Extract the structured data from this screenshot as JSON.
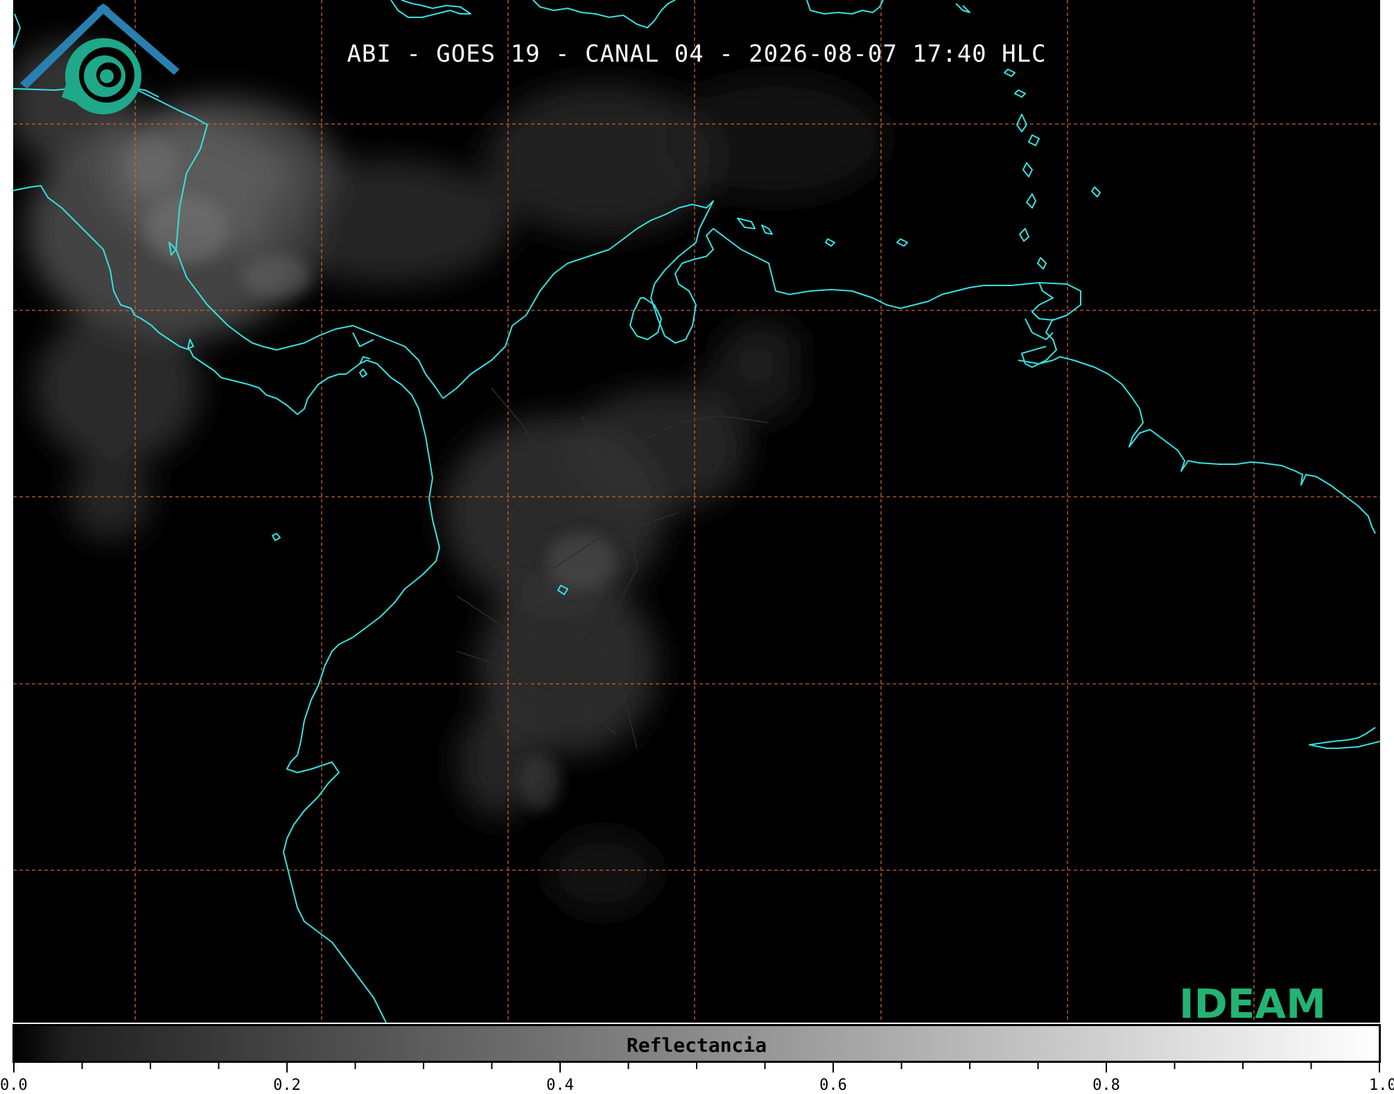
{
  "title": "ABI - GOES 19 - CANAL 04 - 2026-08-07 17:40 HLC",
  "colorbar": {
    "label": "Reflectancia",
    "range": [
      0.0,
      1.0
    ],
    "tick_labels": [
      "0.0",
      "0.2",
      "0.4",
      "0.6",
      "0.8",
      "1.0"
    ],
    "tick_values": [
      0.0,
      0.2,
      0.4,
      0.6,
      0.8,
      1.0
    ],
    "minor_tick_step": 0.05,
    "colormap": "grayscale black to white"
  },
  "map": {
    "background_color": "#000000",
    "coastline_color": "#38e0e0",
    "gridline_color": "#c8662e",
    "gridline_style": "dashed",
    "border_color": "#3a3a3a"
  },
  "logo": {
    "text": "IDEAM",
    "text_color": "#23b373",
    "roof_color": "#2a7fb0",
    "spiral_color": "#1fa88a",
    "icon": "ideam-spiral-logo-icon"
  }
}
